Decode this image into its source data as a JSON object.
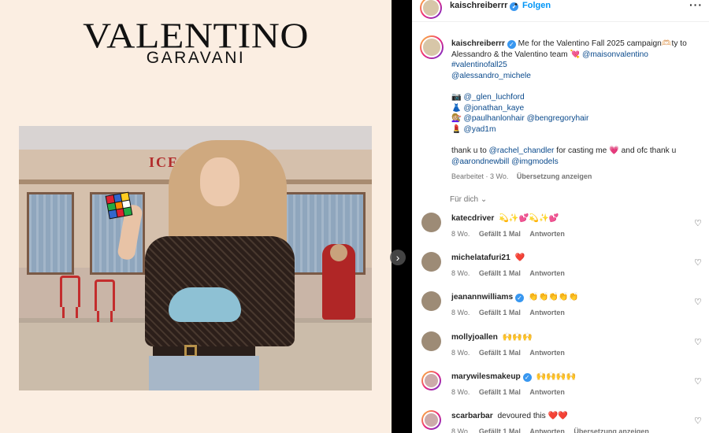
{
  "media": {
    "brand_main": "VALENTINO",
    "brand_sub": "GARAVANI",
    "photo_sign": "ICE CREAM",
    "next_icon": "chevron-right-icon"
  },
  "header": {
    "username": "kaischreiberrr",
    "follow_label": "Folgen",
    "more_icon": "more-horizontal-icon"
  },
  "caption": {
    "username": "kaischreiberrr",
    "line1_text": "Me for the Valentino Fall 2025 campaign🫶🏻ty to",
    "line2_text": "Alessandro & the Valentino team 💘",
    "line2_mention": "@maisonvalentino",
    "hashtag": "#valentinofall25",
    "mention_alessandro": "@alessandro_michele",
    "credit1_icon": "📷",
    "credit1_handle": "@_glen_luchford",
    "credit2_icon": "👗",
    "credit2_handle": "@jonathan_kaye",
    "credit3_icon": "💇🏼‍♀️",
    "credit3_handle_a": "@paulhanlonhair",
    "credit3_handle_b": "@bengregoryhair",
    "credit4_icon": "💄",
    "credit4_handle": "@yad1m",
    "thanks_prefix": "thank u to",
    "thanks_handle": "@rachel_chandler",
    "thanks_mid": "for casting me 💗  and ofc thank u",
    "thanks_handle_b": "@aarondnewbill",
    "thanks_handle_c": "@imgmodels",
    "edited": "Bearbeitet · 3 Wo.",
    "translate": "Übersetzung anzeigen"
  },
  "for_you_label": "Für dich ⌄",
  "comments": [
    {
      "user": "katecdriver",
      "text": "💫✨💕💫✨💕",
      "age": "8 Wo.",
      "likes": "Gefällt 1 Mal",
      "reply": "Antworten"
    },
    {
      "user": "michelatafuri21",
      "text": "❤️",
      "age": "8 Wo.",
      "likes": "Gefällt 1 Mal",
      "reply": "Antworten"
    },
    {
      "user": "jeanannwilliams",
      "text": "👏👏👏👏👏",
      "age": "8 Wo.",
      "likes": "Gefällt 1 Mal",
      "reply": "Antworten"
    },
    {
      "user": "mollyjoallen",
      "text": "🙌🙌🙌",
      "age": "8 Wo.",
      "likes": "Gefällt 1 Mal",
      "reply": "Antworten"
    },
    {
      "user": "marywilesmakeup",
      "text": "🙌🙌🙌🙌",
      "age": "8 Wo.",
      "likes": "Gefällt 1 Mal",
      "reply": "Antworten"
    },
    {
      "user": "scarbarbar",
      "text": "devoured this ❤️❤️",
      "age": "8 Wo.",
      "likes": "Gefällt 1 Mal",
      "reply": "Antworten",
      "translate": "Übersetzung anzeigen"
    }
  ],
  "colors": {
    "link": "#00376b",
    "follow": "#0095f6",
    "verified": "#3897f0",
    "media_bg": "#fbeee2"
  }
}
